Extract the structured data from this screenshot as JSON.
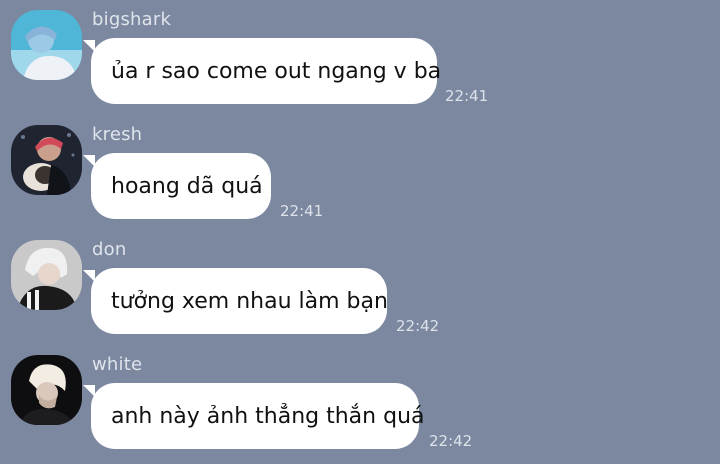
{
  "messages": [
    {
      "sender": "bigshark",
      "text": "ủa r sao come out ngang v ba",
      "time": "22:41"
    },
    {
      "sender": "kresh",
      "text": "hoang dã quá",
      "time": "22:41"
    },
    {
      "sender": "don",
      "text": "tưởng xem nhau làm bạn",
      "time": "22:42"
    },
    {
      "sender": "white",
      "text": "anh này ảnh thẳng thắn quá",
      "time": "22:42"
    }
  ],
  "colors": {
    "background": "#7c88a0",
    "bubble": "#ffffff",
    "text": "#111111",
    "meta_text": "#dde2ea"
  }
}
